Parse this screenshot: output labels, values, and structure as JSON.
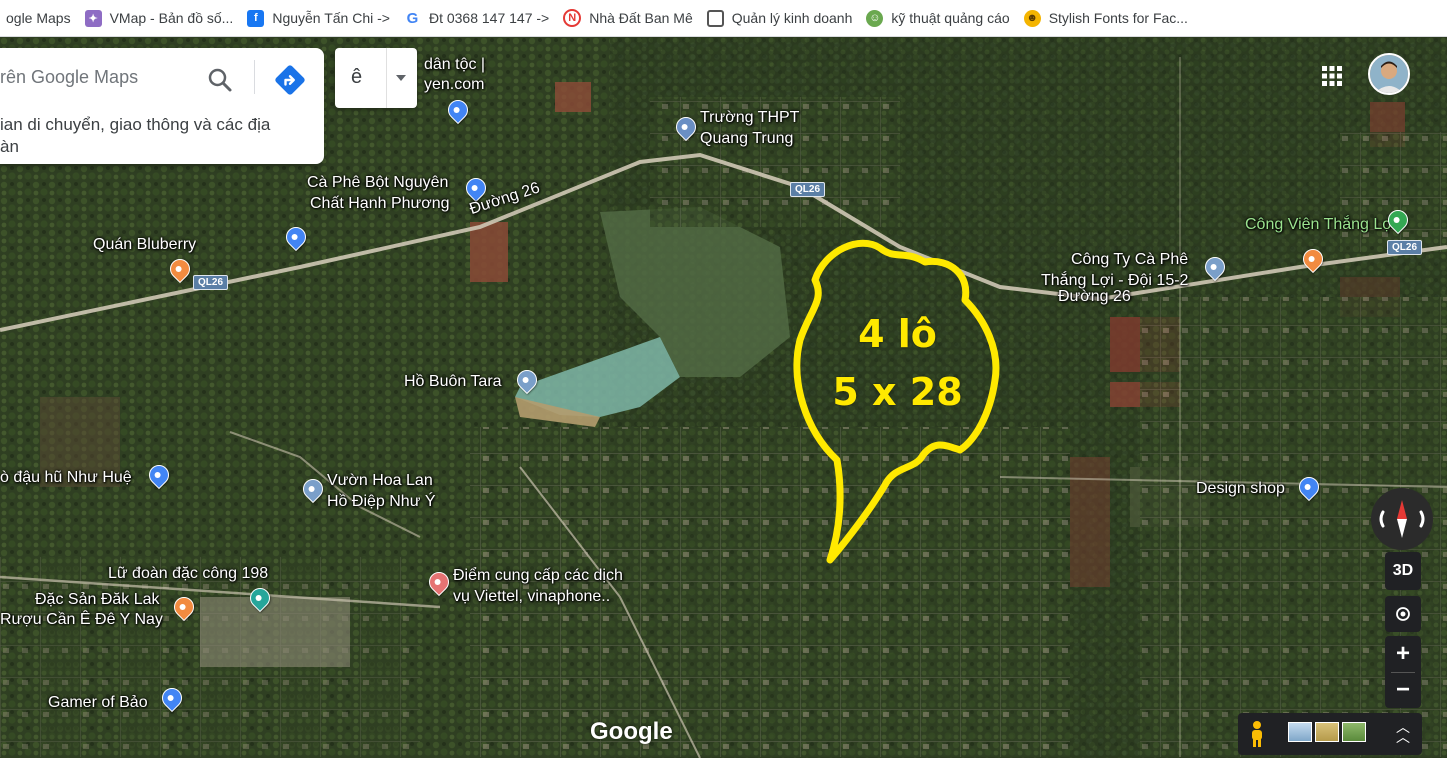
{
  "bookmarks": [
    {
      "label": "ogle Maps",
      "icon": "google-maps-icon",
      "color": "#34a853"
    },
    {
      "label": "VMap - Bản đồ số...",
      "icon": "vmap-icon",
      "color": "#8e6cc4"
    },
    {
      "label": "Nguyễn Tấn Chi ->",
      "icon": "facebook-icon",
      "color": "#1877f2"
    },
    {
      "label": "Đt 0368 147 147 ->",
      "icon": "google-icon",
      "color": "#4285f4"
    },
    {
      "label": "Nhà Đất Ban Mê",
      "icon": "nhadat-icon",
      "color": "#e53935"
    },
    {
      "label": "Quản lý kinh doanh",
      "icon": "document-icon",
      "color": "#555555"
    },
    {
      "label": "kỹ thuật quảng cáo",
      "icon": "cartoon-icon",
      "color": "#6aa84f"
    },
    {
      "label": "Stylish Fonts for Fac...",
      "icon": "smiley-icon",
      "color": "#f4b400"
    }
  ],
  "search": {
    "placeholder": "rên Google Maps",
    "info_text_line1": "ian di chuyển, giao thông và các địa",
    "info_text_line2": "àn"
  },
  "language": {
    "value": "ê"
  },
  "map_labels": [
    {
      "text": "dân tộc |",
      "pin": null
    },
    {
      "text": "yen.com",
      "pin": "shopping"
    },
    {
      "text": "Trường THPT",
      "pin": null
    },
    {
      "text": "Quang Trung",
      "pin": "school"
    },
    {
      "text": "Cà Phê Bột Nguyên",
      "pin": "shopping"
    },
    {
      "text": "Chất Hạnh Phương",
      "pin": null
    },
    {
      "text": "Đường 26",
      "pin": null
    },
    {
      "text": "Quán Bluberry",
      "pin": "shopping"
    },
    {
      "text": "Công Viên Thắng Lợi",
      "pin": "park"
    },
    {
      "text": "Công Ty Cà Phê",
      "pin": null
    },
    {
      "text": "Thắng Lợi - Đội 15-2",
      "pin": "place"
    },
    {
      "text": "Đường 26",
      "pin": null
    },
    {
      "text": "Hồ Buôn Tara",
      "pin": "place"
    },
    {
      "text": "ò đậu hũ Như Huệ",
      "pin": "shopping"
    },
    {
      "text": "Vườn Hoa Lan",
      "pin": "place"
    },
    {
      "text": "Hồ Điệp Như Ý",
      "pin": null
    },
    {
      "text": "Design shop",
      "pin": "shopping"
    },
    {
      "text": "Lữ đoàn đặc công 198",
      "pin": null
    },
    {
      "text": "Đặc Sản Đăk Lak",
      "pin": "food"
    },
    {
      "text": "Rượu Cần Ê Đê Y Nay",
      "pin": null
    },
    {
      "text": "Điểm cung cấp các dịch",
      "pin": "store"
    },
    {
      "text": "vụ Viettel, vinaphone..",
      "pin": null
    },
    {
      "text": "Gamer of Bảo",
      "pin": "shopping"
    }
  ],
  "road_shields": [
    "QL26",
    "QL26",
    "QL26"
  ],
  "annotation": {
    "line1": "4 lô",
    "line2": "5 x 28",
    "color": "#ffe900"
  },
  "controls": {
    "btn_3d": "3D",
    "zoom_in": "+",
    "zoom_out": "−"
  },
  "logo": "Google"
}
